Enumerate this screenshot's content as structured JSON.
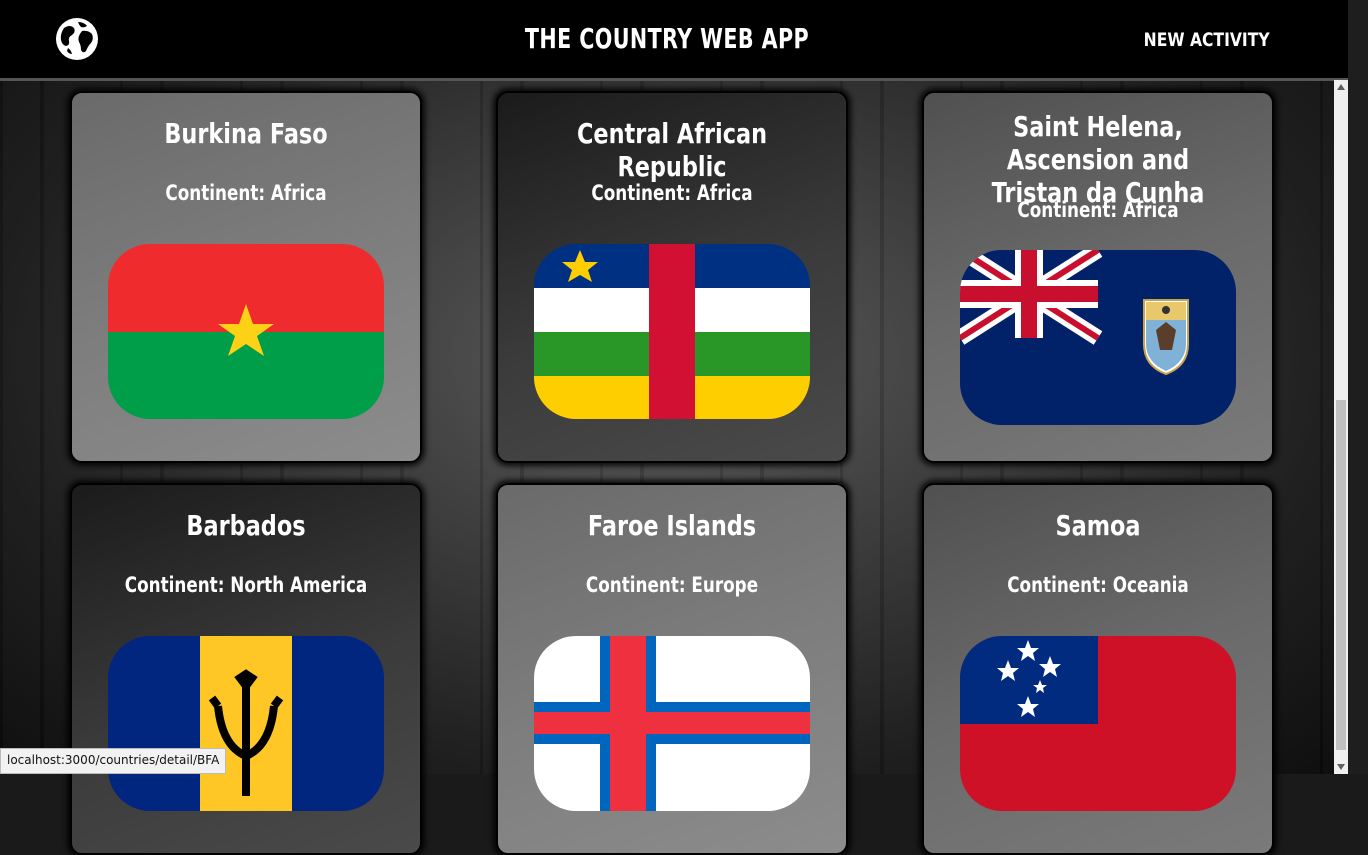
{
  "header": {
    "title": "THE COUNTRY WEB APP",
    "nav_new_activity": "NEW ACTIVITY",
    "logo_icon": "globe-icon"
  },
  "cards": [
    {
      "name": "Burkina Faso",
      "continent": "Continent: Africa",
      "flag": "burkina-faso-flag"
    },
    {
      "name": "Central African Republic",
      "continent": "Continent: Africa",
      "flag": "central-african-republic-flag"
    },
    {
      "name": "Saint Helena, Ascension and Tristan da Cunha",
      "continent": "Continent: Africa",
      "flag": "saint-helena-flag"
    },
    {
      "name": "Barbados",
      "continent": "Continent: North America",
      "flag": "barbados-flag"
    },
    {
      "name": "Faroe Islands",
      "continent": "Continent: Europe",
      "flag": "faroe-islands-flag"
    },
    {
      "name": "Samoa",
      "continent": "Continent: Oceania",
      "flag": "samoa-flag"
    }
  ],
  "status_bar": {
    "url": "localhost:3000/countries/detail/BFA"
  },
  "colors": {
    "header_bg": "#000000",
    "accent_text": "#ffffff"
  }
}
